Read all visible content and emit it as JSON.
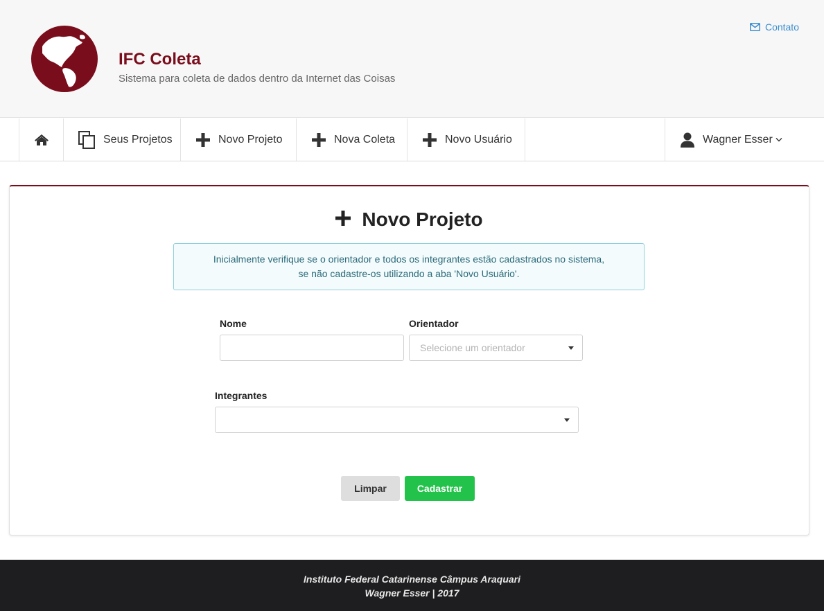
{
  "header": {
    "title": "IFC Coleta",
    "subtitle": "Sistema para coleta de dados dentro da Internet das Coisas",
    "contact_label": "Contato",
    "logo_icon": "globe-americas-icon",
    "brand_color": "#7a0d1c"
  },
  "nav": {
    "home_icon": "home-icon",
    "items": [
      {
        "label": "Seus Projetos",
        "icon": "copy-icon"
      },
      {
        "label": "Novo Projeto",
        "icon": "plus-icon"
      },
      {
        "label": "Nova Coleta",
        "icon": "plus-icon"
      },
      {
        "label": "Novo Usuário",
        "icon": "plus-icon"
      }
    ],
    "user": {
      "name": "Wagner Esser",
      "icon": "user-icon"
    }
  },
  "form": {
    "title": "Novo Projeto",
    "notice_line1": "Inicialmente verifique se o orientador e todos os integrantes estão cadastrados no sistema,",
    "notice_line2": "se não cadastre-os utilizando a aba 'Novo Usuário'.",
    "nome_label": "Nome",
    "nome_value": "",
    "orientador_label": "Orientador",
    "orientador_placeholder": "Selecione um orientador",
    "integrantes_label": "Integrantes",
    "integrantes_value": "",
    "clear_label": "Limpar",
    "submit_label": "Cadastrar",
    "submit_color": "#23c24a"
  },
  "footer": {
    "line1": "Instituto Federal Catarinense Câmpus Araquari",
    "line2": "Wagner Esser | 2017"
  }
}
